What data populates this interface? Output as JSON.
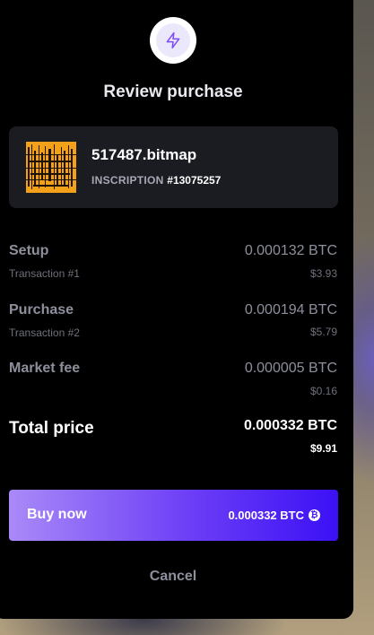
{
  "modal": {
    "title": "Review purchase",
    "icon": "lightning-bolt-icon",
    "accent_color": "#7b4cf6"
  },
  "item": {
    "name": "517487.bitmap",
    "inscription_label": "INSCRIPTION",
    "inscription_number": "#13075257",
    "thumbnail_color": "#f4a11a"
  },
  "rows": [
    {
      "label": "Setup",
      "sublabel": "Transaction #1",
      "btc": "0.000132 BTC",
      "usd": "$3.93"
    },
    {
      "label": "Purchase",
      "sublabel": "Transaction #2",
      "btc": "0.000194 BTC",
      "usd": "$5.79"
    },
    {
      "label": "Market fee",
      "sublabel": "",
      "btc": "0.000005 BTC",
      "usd": "$0.16"
    }
  ],
  "total": {
    "label": "Total price",
    "btc": "0.000332 BTC",
    "usd": "$9.91"
  },
  "buy_button": {
    "label": "Buy now",
    "price": "0.000332 BTC",
    "icon": "bitcoin-icon"
  },
  "cancel_label": "Cancel"
}
